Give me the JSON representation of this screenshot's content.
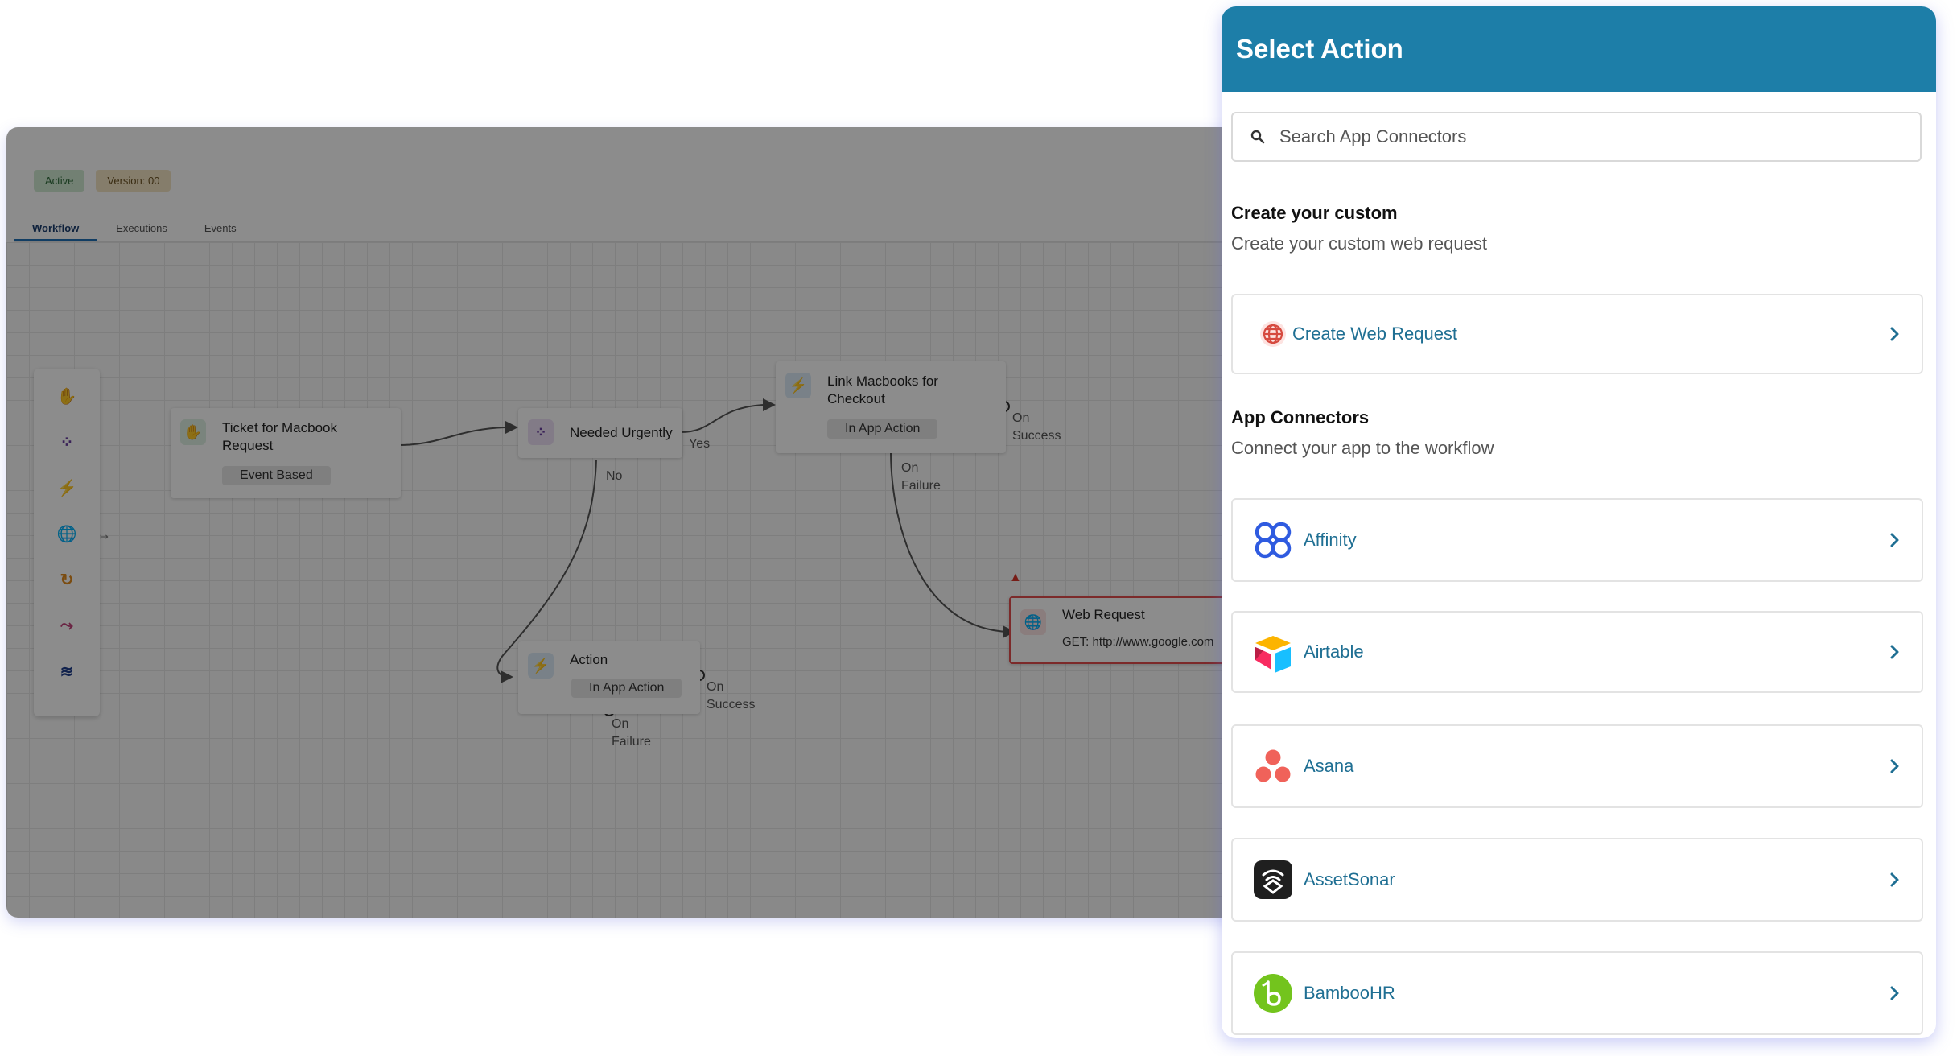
{
  "editor": {
    "status": "Active",
    "version": "Version: 00",
    "tabs": [
      "Workflow",
      "Executions",
      "Events"
    ],
    "nodes": {
      "trigger": {
        "title_line1": "Ticket for Macbook",
        "title_line2": "Request",
        "tag": "Event Based"
      },
      "condition": {
        "title": "Needed Urgently"
      },
      "link": {
        "title_line1": "Link Macbooks for",
        "title_line2": "Checkout",
        "tag": "In App Action"
      },
      "action": {
        "title": "Action",
        "tag": "In App Action"
      },
      "web": {
        "title": "Web Request",
        "detail": "GET: http://www.google.com"
      }
    },
    "edge_labels": {
      "yes": "Yes",
      "no": "No",
      "on": "On",
      "success": "Success",
      "failure": "Failure"
    }
  },
  "panel": {
    "title": "Select Action",
    "search_placeholder": "Search App Connectors",
    "custom": {
      "title": "Create your custom",
      "subtitle": "Create your custom web request",
      "card_label": "Create Web Request"
    },
    "connectors": {
      "title": "App Connectors",
      "subtitle": "Connect your app to the workflow",
      "items": [
        {
          "label": "Affinity",
          "icon": "affinity-icon"
        },
        {
          "label": "Airtable",
          "icon": "airtable-icon"
        },
        {
          "label": "Asana",
          "icon": "asana-icon"
        },
        {
          "label": "AssetSonar",
          "icon": "assetsonar-icon"
        },
        {
          "label": "BambooHR",
          "icon": "bamboohr-icon"
        }
      ]
    }
  },
  "colors": {
    "header": "#1d7ea8",
    "link_text": "#1f6f93",
    "overlay": "rgba(0,0,0,0.45)"
  }
}
